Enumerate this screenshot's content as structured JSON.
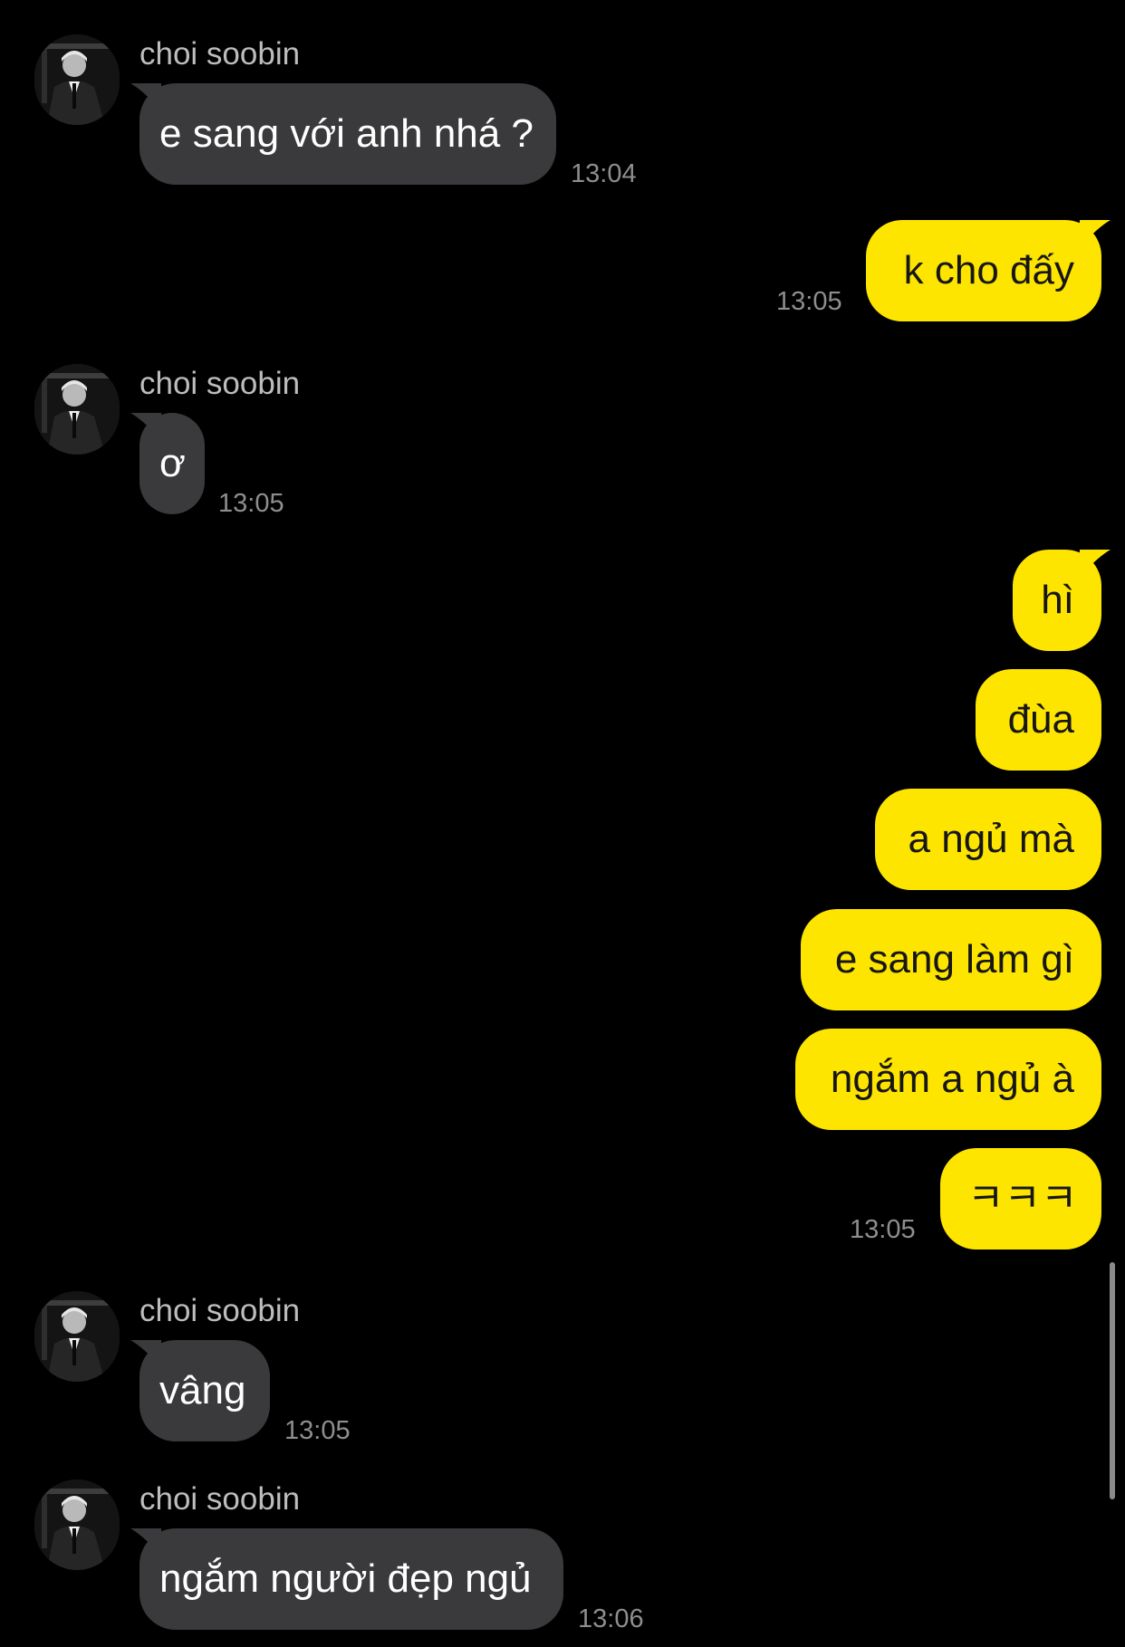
{
  "colors": {
    "background": "#000000",
    "incoming_bubble": "#3a3a3c",
    "outgoing_bubble": "#fee500",
    "outgoing_text": "#161616",
    "timestamp": "#8e8e8e",
    "sender_name": "#bdbdbd"
  },
  "messages": [
    {
      "direction": "incoming",
      "sender": "choi soobin",
      "text": "e sang với anh nhá ?",
      "time": "13:04"
    },
    {
      "direction": "outgoing",
      "text": "k cho đấy",
      "time": "13:05"
    },
    {
      "direction": "incoming",
      "sender": "choi soobin",
      "text": "ơ",
      "time": "13:05"
    },
    {
      "direction": "outgoing",
      "text": "hì",
      "time": ""
    },
    {
      "direction": "outgoing",
      "text": "đùa",
      "time": ""
    },
    {
      "direction": "outgoing",
      "text": "a ngủ mà",
      "time": ""
    },
    {
      "direction": "outgoing",
      "text": "e sang làm gì",
      "time": ""
    },
    {
      "direction": "outgoing",
      "text": "ngắm a ngủ à",
      "time": ""
    },
    {
      "direction": "outgoing",
      "text": "ㅋㅋㅋ",
      "time": "13:05"
    },
    {
      "direction": "incoming",
      "sender": "choi soobin",
      "text": "vâng",
      "time": "13:05"
    },
    {
      "direction": "incoming",
      "sender": "choi soobin",
      "text": "ngắm người đẹp ngủ",
      "time": "13:06"
    }
  ],
  "icons": {
    "avatar": "profile-photo"
  }
}
